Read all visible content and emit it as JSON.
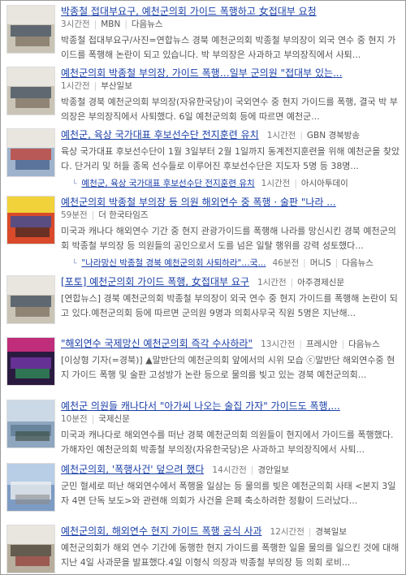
{
  "items": [
    {
      "title": "박종철 접대부요구, 예천군의회 가이드 폭행하고 女접대부 요청",
      "meta": {
        "time": "3시간전",
        "sources": [
          "MBN",
          "다음뉴스"
        ]
      },
      "desc": "박종철 접대부요구/사진=연합뉴스 경북 예천군의회 박종철 부의장이 외국 연수 중 현지 가이드를 폭행해 논란이 되고 있습니다. 박 부의장은 사과하고 부의장직에서 사퇴..."
    },
    {
      "title": "예천군의회 박종철 부의장, 가이드 폭행…일부 군의원 \"접대부 있는...",
      "meta": {
        "time": "1시간전",
        "sources": [
          "부산일보"
        ]
      },
      "desc": "박종철 경북 예천군의회 부의장(자유한국당)이 국외연수 중 현지 가이드를 폭행, 결국 박 부의장은 부의장직에서 사퇴했다. 6일 예천군의회 등에 따르면 예천군..."
    },
    {
      "title": "예천군, 육상 국가대표 후보선수단 전지훈련 유치",
      "meta": {
        "time": "1시간전",
        "sources": [
          "GBN 경북방송"
        ]
      },
      "desc": "육상 국가대표 후보선수단이 1월 3일부터 2월 1일까지 동계전지훈련을 위해 예천군을 찾았다. 단거리 및 허들 종목 선수들로 이루어진 후보선수단은 지도자 5명 등 38명...",
      "related": {
        "text": "예천군, 육상 국가대표 후보선수단 전지훈련 유치",
        "time": "1시간전",
        "source": "아시아투데이"
      }
    },
    {
      "title": "예천군의회 박종철 부의장 등 의원 해외연수 중 폭행 · 술판 \"나라 ...",
      "meta": {
        "time": "59분전",
        "sources": [
          "더 한국타임즈"
        ]
      },
      "desc": "미국과 캐나다 해외연수 기간 중 현지 관광가이드를 폭행해 나라를 망신시킨 경북 예천군의회 박종철 부의장 등 의원들의 공인으로서 도를 넘은 일탈 행위를 강력 성토했다...",
      "related": {
        "text": "\"나라망신 박종철 경북 예천군의회 사퇴하라\"…국...",
        "time": "46분전",
        "source": "머니S",
        "extra": "다음뉴스"
      }
    },
    {
      "title": "[포토] 예천군의회 가이드 폭행, 女접대부 요구",
      "meta": {
        "time": "1시간전",
        "sources": [
          "아주경제신문"
        ]
      },
      "desc": "[연합뉴스] 경북 예천군의회 박종철 부의장이 외국 연수 중 현지 가이드를 폭행해 논란이 되고 있다.예천군의회 등에 따르면 군의원 9명과 의회사무국 직원 5명은 지난해..."
    },
    {
      "title": "\"해외연수 국제망신 예천군의회 즉각 수사하라\"",
      "meta": {
        "time": "13시간전",
        "sources": [
          "프레시안",
          "다음뉴스"
        ]
      },
      "desc": "[이상형 기자(=경북)] ▲말반단의 예천군의회 앞에서의 시위 모습 ⓒ말반단 해외연수중 현지 가이드 폭행 및 술판 고성방가 논란 등으로 물의를 빚고 있는 경북 예천군의회..."
    },
    {
      "title": "예천군 의원들 캐나다서 \"아가씨 나오는 술집 가자\" 가이드도 폭행,...",
      "meta": {
        "time": "10분전",
        "sources": [
          "국제신문"
        ]
      },
      "desc": "미국과 캐나다로 해외연수를 떠난 경북 예천군의회 의원들이 현지에서 가이드를 폭행했다. 가해자인 예천군의회 박종철 부의장(자유한국당)은 사과하고 부의장직에서 사퇴..."
    },
    {
      "title": "예천군의회, '폭행사건' 덮으려 했다",
      "meta": {
        "time": "14시간전",
        "sources": [
          "경안일보"
        ]
      },
      "desc": "군민 혈세로 떠난 해외연수에서 폭행을 일삼는 등 물의를 빚은 예천군의회 사태 <본지 3일자 4면 단독 보도>와 관련해 의회가 사건을 은폐 축소하려한 정황이 드러났다..."
    },
    {
      "title": "예천군의회, 해외연수 현지 가이드 폭행 공식 사과",
      "meta": {
        "time": "12시간전",
        "sources": [
          "경북일보"
        ]
      },
      "desc": "예천군의회가 해외 연수 기간에 동행한 현지 가이드를 폭행한 일을 물의를 일으킨 것에 대해 지난 4일 사과문을 발표했다.4일 이형식 의장과 박종철 부의장 등 의회 로비..."
    }
  ]
}
